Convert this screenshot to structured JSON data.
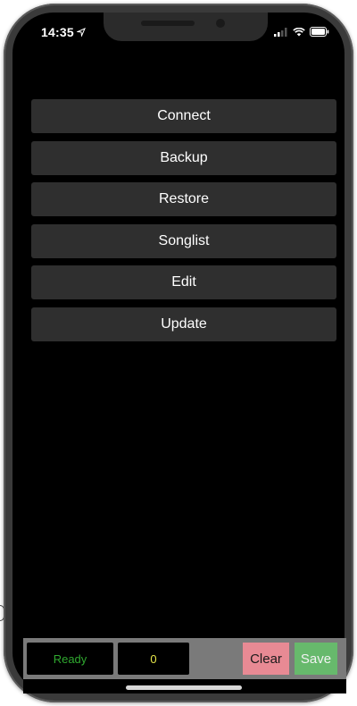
{
  "status_bar": {
    "time": "14:35",
    "icons": [
      "location-arrow-icon",
      "signal-icon",
      "wifi-icon",
      "battery-icon"
    ]
  },
  "menu": {
    "items": [
      {
        "label": "Connect"
      },
      {
        "label": "Backup"
      },
      {
        "label": "Restore"
      },
      {
        "label": "Songlist"
      },
      {
        "label": "Edit"
      },
      {
        "label": "Update"
      }
    ]
  },
  "bottom_bar": {
    "status_text": "Ready",
    "count": "0",
    "clear_label": "Clear",
    "save_label": "Save"
  },
  "colors": {
    "background": "#000000",
    "menu_button": "#2f2f2f",
    "status_ready_text": "#2fa82f",
    "count_text": "#e6e64a",
    "clear_button": "#e88a94",
    "save_button": "#67b96c"
  }
}
